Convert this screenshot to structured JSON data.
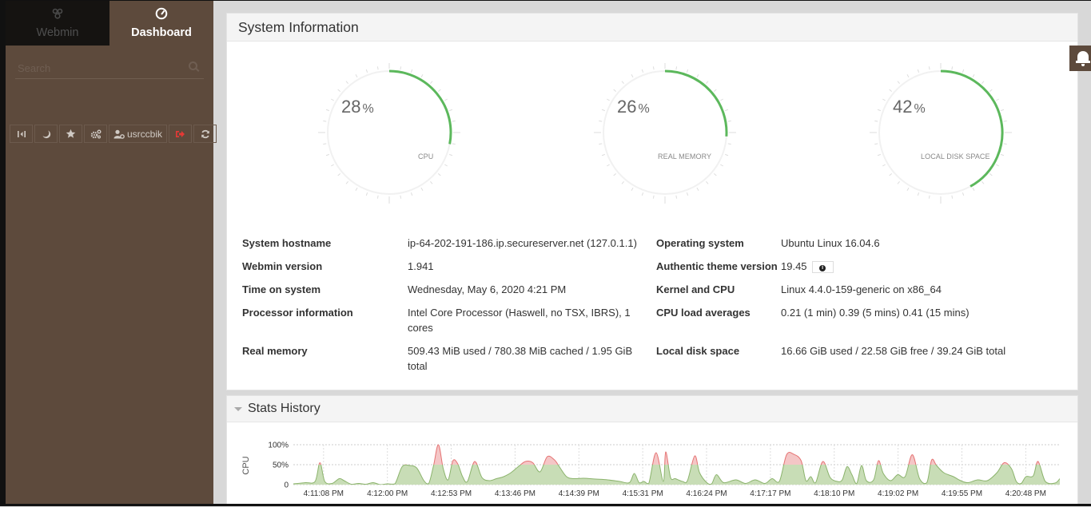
{
  "sidebar": {
    "tabs": [
      {
        "label": "Webmin",
        "icon": "webmin-logo-icon",
        "active": false
      },
      {
        "label": "Dashboard",
        "icon": "dashboard-gauge-icon",
        "active": true
      }
    ],
    "search": {
      "placeholder": "Search",
      "value": ""
    },
    "toolbar": [
      {
        "icon": "collapse-sidebar-icon",
        "glyph": "|◂|",
        "title": "Toggle sidebar"
      },
      {
        "icon": "moon-icon",
        "glyph": "☽",
        "title": "Night mode"
      },
      {
        "icon": "star-icon",
        "glyph": "★",
        "title": "Favorites"
      },
      {
        "icon": "gears-icon",
        "glyph": "⚙",
        "title": "Theme configuration"
      },
      {
        "icon": "user-gear-icon",
        "glyph": "👤",
        "label": "usrccbik"
      },
      {
        "icon": "logout-icon",
        "glyph": "➜",
        "title": "Logout"
      },
      {
        "icon": "refresh-icon",
        "glyph": "⟳",
        "title": "Refresh"
      }
    ]
  },
  "system_info": {
    "title": "System Information",
    "gauges": [
      {
        "label": "CPU",
        "value": 28,
        "unit": "%"
      },
      {
        "label": "REAL MEMORY",
        "value": 26,
        "unit": "%"
      },
      {
        "label": "LOCAL DISK SPACE",
        "value": 42,
        "unit": "%"
      }
    ],
    "left": [
      {
        "key": "System hostname",
        "value": "ip-64-202-191-186.ip.secureserver.net (127.0.1.1)"
      },
      {
        "key": "Webmin version",
        "value": "1.941"
      },
      {
        "key": "Time on system",
        "value": "Wednesday, May 6, 2020 4:21 PM"
      },
      {
        "key": "Processor information",
        "value": "Intel Core Processor (Haswell, no TSX, IBRS), 1 cores"
      },
      {
        "key": "Real memory",
        "value": "509.43 MiB used / 780.38 MiB cached / 1.95 GiB total"
      }
    ],
    "right": [
      {
        "key": "Operating system",
        "value": "Ubuntu Linux 16.04.6"
      },
      {
        "key": "Authentic theme version",
        "value": "19.45"
      },
      {
        "key": "Kernel and CPU",
        "value": "Linux 4.4.0-159-generic on x86_64"
      },
      {
        "key": "CPU load averages",
        "value": "0.21 (1 min) 0.39 (5 mins) 0.41 (15 mins)"
      },
      {
        "key": "Local disk space",
        "value": "16.66 GiB used / 22.58 GiB free / 39.24 GiB total"
      }
    ],
    "theme_info_button": "info-circle-icon"
  },
  "stats_history": {
    "title": "Stats History",
    "collapsed": false
  },
  "notifications": {
    "icon": "bell-icon"
  },
  "colors": {
    "sidebar_bg": "#5d4a3c",
    "gauge_arc": "#5cb85c",
    "chart_fill_normal": "#c8ddb6",
    "chart_line_normal": "#8bb36c",
    "chart_fill_high": "#f4c6c6",
    "chart_line_high": "#e57373"
  },
  "chart_data": {
    "type": "area",
    "title": "",
    "ylabel": "CPU",
    "xlabel": "",
    "ylim": [
      0,
      100
    ],
    "ytick_labels": [
      "0",
      "50%",
      "100%"
    ],
    "threshold": 50,
    "grid": true,
    "x_tick_labels": [
      "4:11:08 PM",
      "4:12:00 PM",
      "4:12:53 PM",
      "4:13:46 PM",
      "4:14:39 PM",
      "4:15:31 PM",
      "4:16:24 PM",
      "4:17:17 PM",
      "4:18:10 PM",
      "4:19:02 PM",
      "4:19:55 PM",
      "4:20:48 PM"
    ],
    "x_start_sec": 0,
    "x_end_sec": 634,
    "series": [
      {
        "name": "CPU",
        "x_sec": [
          0,
          10,
          18,
          22,
          26,
          32,
          38,
          42,
          48,
          54,
          60,
          66,
          72,
          78,
          84,
          90,
          96,
          102,
          108,
          112,
          116,
          120,
          124,
          128,
          132,
          136,
          140,
          144,
          150,
          156,
          162,
          168,
          174,
          180,
          186,
          192,
          198,
          204,
          210,
          216,
          220,
          226,
          232,
          240,
          250,
          260,
          270,
          278,
          282,
          286,
          290,
          294,
          300,
          306,
          308,
          312,
          316,
          322,
          326,
          332,
          336,
          342,
          346,
          350,
          356,
          366,
          374,
          382,
          390,
          396,
          402,
          408,
          414,
          420,
          424,
          428,
          432,
          438,
          444,
          450,
          454,
          458,
          462,
          466,
          470,
          474,
          480,
          484,
          488,
          494,
          500,
          506,
          512,
          518,
          524,
          528,
          532,
          538,
          546,
          552,
          558,
          566,
          574,
          582,
          588,
          594,
          598,
          602,
          606,
          612,
          616,
          622,
          630,
          634
        ],
        "values": [
          2,
          5,
          8,
          55,
          8,
          3,
          15,
          10,
          1,
          3,
          1,
          5,
          0,
          2,
          2,
          45,
          48,
          42,
          10,
          3,
          48,
          100,
          40,
          12,
          60,
          52,
          20,
          8,
          58,
          18,
          10,
          15,
          20,
          30,
          45,
          58,
          55,
          32,
          70,
          62,
          45,
          20,
          15,
          16,
          14,
          12,
          8,
          5,
          28,
          5,
          8,
          3,
          80,
          8,
          82,
          18,
          15,
          8,
          10,
          72,
          30,
          5,
          2,
          25,
          5,
          12,
          3,
          12,
          3,
          15,
          8,
          75,
          76,
          60,
          10,
          20,
          5,
          58,
          18,
          8,
          12,
          45,
          25,
          3,
          48,
          10,
          12,
          60,
          28,
          10,
          25,
          20,
          75,
          15,
          5,
          62,
          48,
          30,
          20,
          10,
          5,
          12,
          10,
          30,
          55,
          40,
          8,
          3,
          20,
          22,
          58,
          8,
          4,
          15
        ]
      }
    ]
  }
}
